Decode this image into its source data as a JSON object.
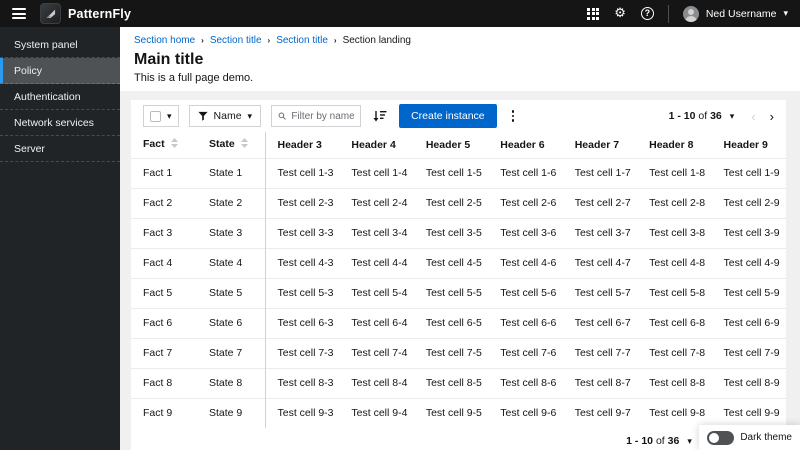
{
  "masthead": {
    "brand": "PatternFly",
    "user": "Ned Username"
  },
  "sidebar": {
    "items": [
      {
        "label": "System panel",
        "active": false
      },
      {
        "label": "Policy",
        "active": true
      },
      {
        "label": "Authentication",
        "active": false
      },
      {
        "label": "Network services",
        "active": false
      },
      {
        "label": "Server",
        "active": false
      }
    ]
  },
  "page": {
    "breadcrumb": [
      {
        "label": "Section home",
        "current": false
      },
      {
        "label": "Section title",
        "current": false
      },
      {
        "label": "Section title",
        "current": false
      },
      {
        "label": "Section landing",
        "current": true
      }
    ],
    "title": "Main title",
    "subtitle": "This is a full page demo."
  },
  "toolbar": {
    "filter_label": "Name",
    "search_placeholder": "Filter by name",
    "create_label": "Create instance"
  },
  "pagination": {
    "range": "1 - 10",
    "of_label": "of",
    "total": "36"
  },
  "table": {
    "headers": [
      {
        "label": "Fact",
        "sortable": true
      },
      {
        "label": "State",
        "sortable": true
      },
      {
        "label": "Header 3",
        "sortable": false
      },
      {
        "label": "Header 4",
        "sortable": false
      },
      {
        "label": "Header 5",
        "sortable": false
      },
      {
        "label": "Header 6",
        "sortable": false
      },
      {
        "label": "Header 7",
        "sortable": false
      },
      {
        "label": "Header 8",
        "sortable": false
      },
      {
        "label": "Header 9",
        "sortable": false
      }
    ],
    "rows": [
      [
        "Fact 1",
        "State 1",
        "Test cell 1-3",
        "Test cell 1-4",
        "Test cell 1-5",
        "Test cell 1-6",
        "Test cell 1-7",
        "Test cell 1-8",
        "Test cell 1-9"
      ],
      [
        "Fact 2",
        "State 2",
        "Test cell 2-3",
        "Test cell 2-4",
        "Test cell 2-5",
        "Test cell 2-6",
        "Test cell 2-7",
        "Test cell 2-8",
        "Test cell 2-9"
      ],
      [
        "Fact 3",
        "State 3",
        "Test cell 3-3",
        "Test cell 3-4",
        "Test cell 3-5",
        "Test cell 3-6",
        "Test cell 3-7",
        "Test cell 3-8",
        "Test cell 3-9"
      ],
      [
        "Fact 4",
        "State 4",
        "Test cell 4-3",
        "Test cell 4-4",
        "Test cell 4-5",
        "Test cell 4-6",
        "Test cell 4-7",
        "Test cell 4-8",
        "Test cell 4-9"
      ],
      [
        "Fact 5",
        "State 5",
        "Test cell 5-3",
        "Test cell 5-4",
        "Test cell 5-5",
        "Test cell 5-6",
        "Test cell 5-7",
        "Test cell 5-8",
        "Test cell 5-9"
      ],
      [
        "Fact 6",
        "State 6",
        "Test cell 6-3",
        "Test cell 6-4",
        "Test cell 6-5",
        "Test cell 6-6",
        "Test cell 6-7",
        "Test cell 6-8",
        "Test cell 6-9"
      ],
      [
        "Fact 7",
        "State 7",
        "Test cell 7-3",
        "Test cell 7-4",
        "Test cell 7-5",
        "Test cell 7-6",
        "Test cell 7-7",
        "Test cell 7-8",
        "Test cell 7-9"
      ],
      [
        "Fact 8",
        "State 8",
        "Test cell 8-3",
        "Test cell 8-4",
        "Test cell 8-5",
        "Test cell 8-6",
        "Test cell 8-7",
        "Test cell 8-8",
        "Test cell 8-9"
      ],
      [
        "Fact 9",
        "State 9",
        "Test cell 9-3",
        "Test cell 9-4",
        "Test cell 9-5",
        "Test cell 9-6",
        "Test cell 9-7",
        "Test cell 9-8",
        "Test cell 9-9"
      ]
    ]
  },
  "theme": {
    "dark_theme_label": "Dark theme",
    "toggle_state": "off"
  },
  "icons": {
    "caret_down": "▾",
    "chevron_left": "‹",
    "chevron_right": "›",
    "chevron_first": "«",
    "chevron_last": "»",
    "gear": "⚙",
    "help": "?"
  },
  "colors": {
    "accent_blue": "#0066cc",
    "link_blue": "#0066cc",
    "masthead_bg": "#151515",
    "sidebar_bg": "#212427",
    "sidebar_active_bg": "#4f5255",
    "sidebar_active_border": "#2b9af3",
    "page_bg": "#f0f0f0",
    "row_border": "#ebebeb",
    "column_divider": "#d2d2d2"
  }
}
